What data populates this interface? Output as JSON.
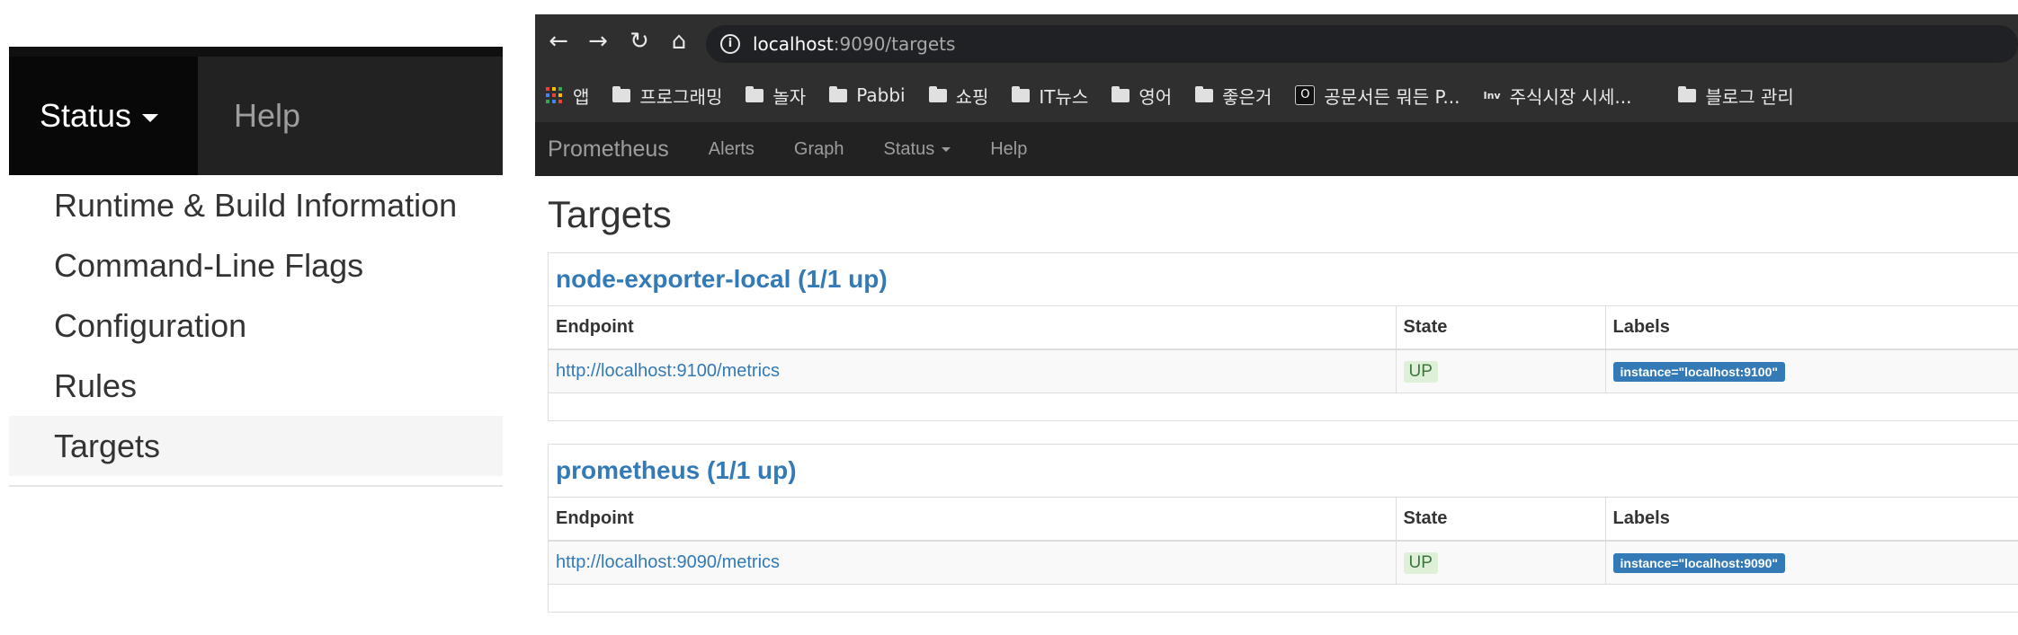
{
  "zoom_menu": {
    "status_label": "Status",
    "help_label": "Help",
    "items": [
      {
        "label": "Runtime & Build Information",
        "active": false
      },
      {
        "label": "Command-Line Flags",
        "active": false
      },
      {
        "label": "Configuration",
        "active": false
      },
      {
        "label": "Rules",
        "active": false
      },
      {
        "label": "Targets",
        "active": true
      }
    ]
  },
  "browser": {
    "url_host": "localhost",
    "url_path": ":9090/targets",
    "bookmarks": [
      {
        "icon": "apps-icon",
        "label": "앱"
      },
      {
        "icon": "folder-icon",
        "label": "프로그래밍"
      },
      {
        "icon": "folder-icon",
        "label": "놀자"
      },
      {
        "icon": "folder-icon",
        "label": "Pabbi"
      },
      {
        "icon": "folder-icon",
        "label": "쇼핑"
      },
      {
        "icon": "folder-icon",
        "label": "IT뉴스"
      },
      {
        "icon": "folder-icon",
        "label": "영어"
      },
      {
        "icon": "folder-icon",
        "label": "좋은거"
      },
      {
        "icon": "o-icon",
        "label": "공문서든 뭐든 P..."
      },
      {
        "icon": "inv-icon",
        "label": "주식시장 시세..."
      },
      {
        "icon": "folder-icon",
        "label": "블로그 관리"
      }
    ],
    "o_icon_text": "O",
    "inv_icon_text": "Inv"
  },
  "prom_nav": {
    "brand": "Prometheus",
    "alerts": "Alerts",
    "graph": "Graph",
    "status": "Status",
    "help": "Help"
  },
  "page": {
    "title": "Targets",
    "columns": {
      "endpoint": "Endpoint",
      "state": "State",
      "labels": "Labels"
    },
    "jobs": [
      {
        "name": "node-exporter-local (1/1 up)",
        "endpoint": "http://localhost:9100/metrics",
        "state": "UP",
        "label": "instance=\"localhost:9100\""
      },
      {
        "name": "prometheus (1/1 up)",
        "endpoint": "http://localhost:9090/metrics",
        "state": "UP",
        "label": "instance=\"localhost:9090\""
      }
    ]
  },
  "colors": {
    "link": "#337ab7",
    "navbar": "#222222",
    "state_up_bg": "#dff0d8",
    "state_up_text": "#3c763d"
  }
}
